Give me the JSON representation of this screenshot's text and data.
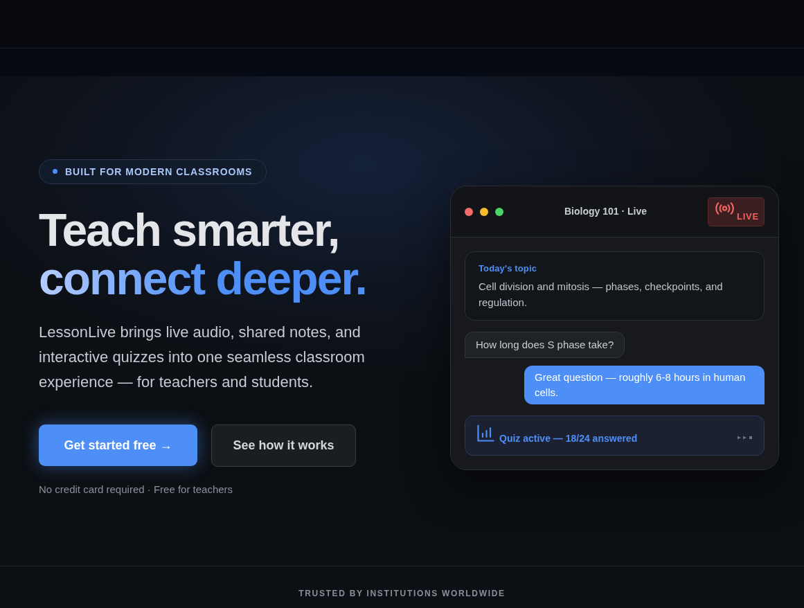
{
  "badge": {
    "text": "BUILT FOR MODERN CLASSROOMS"
  },
  "headline": {
    "line_1": "Teach smarter,",
    "line_2": "connect deeper."
  },
  "description": "LessonLive brings live audio, shared notes, and interactive quizzes into one seamless classroom experience — for teachers and students.",
  "buttons": [
    {
      "label": "Get started free →",
      "kind": "primary"
    },
    {
      "label": "See how it works",
      "kind": "secondary"
    }
  ],
  "note": "No credit card required · Free for teachers",
  "preview_window": {
    "window_controls": [
      {
        "color": "#f36b6b"
      },
      {
        "color": "#f7bd2a"
      },
      {
        "color": "#4cd464"
      }
    ],
    "title": "Biology 101 · Live",
    "live_badge": "LIVE",
    "topic_card": {
      "heading": "Today's topic",
      "text": "Cell division and mitosis — phases, checkpoints, and regulation."
    },
    "messages": [
      {
        "text": "How long does S phase take?",
        "kind": "incoming"
      },
      {
        "text": "Great question — roughly 6-8 hours in human cells.",
        "kind": "outgoing"
      }
    ],
    "quiz_status": "Quiz active — 18/24 answered"
  },
  "trusted_label": "TRUSTED BY INSTITUTIONS WORLDWIDE"
}
